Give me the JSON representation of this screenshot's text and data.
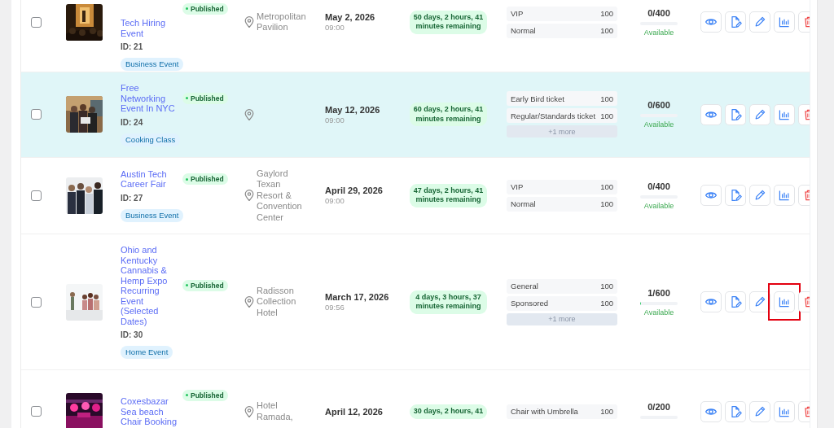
{
  "events": [
    {
      "title": "Tech Hiring Event",
      "id": "ID: 21",
      "category": "Business Event",
      "status": "Published",
      "location": "Metropolitan Pavilion",
      "date": "May 2, 2026",
      "time": "09:00",
      "remaining": "50 days, 2 hours, 41 minutes remaining",
      "tickets": [
        {
          "name": "VIP",
          "qty": "100"
        },
        {
          "name": "Normal",
          "qty": "100"
        }
      ],
      "sold": "0/400",
      "level": 0,
      "availability": "Available",
      "selected": false,
      "checked": false,
      "actions": [
        {
          "kind": "view",
          "highlighted": false
        },
        {
          "kind": "document",
          "highlighted": false
        },
        {
          "kind": "edit",
          "highlighted": false
        },
        {
          "kind": "stats",
          "highlighted": false
        },
        {
          "kind": "delete",
          "highlighted": false
        }
      ]
    },
    {
      "title": "Free Networking Event In NYC",
      "id": "ID: 24",
      "category": "Cooking Class",
      "status": "Published",
      "date": "May 12, 2026",
      "time": "09:00",
      "remaining": "60 days, 2 hours, 41 minutes remaining",
      "tickets": [
        {
          "name": "Early Bird ticket",
          "qty": "100"
        },
        {
          "name": "Regular/Standards ticket",
          "qty": "100"
        }
      ],
      "more": "+1 more",
      "sold": "0/600",
      "level": 0,
      "availability": "Available",
      "selected": true,
      "checked": false,
      "actions": [
        {
          "kind": "view",
          "highlighted": false
        },
        {
          "kind": "document",
          "highlighted": false
        },
        {
          "kind": "edit",
          "highlighted": false
        },
        {
          "kind": "stats",
          "highlighted": false
        },
        {
          "kind": "delete",
          "highlighted": false
        }
      ]
    },
    {
      "title": "Austin Tech Career Fair",
      "id": "ID: 27",
      "category": "Business Event",
      "status": "Published",
      "location": "Gaylord Texan Resort & Convention Center",
      "date": "April 29, 2026",
      "time": "09:00",
      "remaining": "47 days, 2 hours, 41 minutes remaining",
      "tickets": [
        {
          "name": "VIP",
          "qty": "100"
        },
        {
          "name": "Normal",
          "qty": "100"
        }
      ],
      "sold": "0/400",
      "level": 0,
      "availability": "Available",
      "selected": false,
      "checked": false,
      "actions": [
        {
          "kind": "view",
          "highlighted": false
        },
        {
          "kind": "document",
          "highlighted": false
        },
        {
          "kind": "edit",
          "highlighted": false
        },
        {
          "kind": "stats",
          "highlighted": false
        },
        {
          "kind": "delete",
          "highlighted": false
        }
      ]
    },
    {
      "title": "Ohio and Kentucky Cannabis & Hemp Expo Recurring Event (Selected Dates)",
      "id": "ID: 30",
      "category": "Home Event",
      "status": "Published",
      "location": "Radisson Collection Hotel",
      "date": "March 17, 2026",
      "time": "09:56",
      "remaining": "4 days, 3 hours, 37 minutes remaining",
      "tickets": [
        {
          "name": "General",
          "qty": "100"
        },
        {
          "name": "Sponsored",
          "qty": "100"
        }
      ],
      "more": "+1 more",
      "sold": "1/600",
      "level": 0.02,
      "availability": "Available",
      "selected": false,
      "checked": false,
      "actions": [
        {
          "kind": "view",
          "highlighted": false
        },
        {
          "kind": "document",
          "highlighted": false
        },
        {
          "kind": "edit",
          "highlighted": false
        },
        {
          "kind": "stats",
          "highlighted": true
        },
        {
          "kind": "delete",
          "highlighted": false
        }
      ]
    },
    {
      "title": "Coxesbazar Sea beach Chair Booking",
      "status": "Published",
      "location": "Hotel Ramada,",
      "date": "April 12, 2026",
      "remaining": "30 days, 2 hours, 41",
      "tickets": [
        {
          "name": "Chair with Umbrella",
          "qty": "100"
        }
      ],
      "sold": "0/200",
      "level": 0,
      "selected": false,
      "checked": false,
      "actions": [
        {
          "kind": "view",
          "highlighted": false
        },
        {
          "kind": "document",
          "highlighted": false
        },
        {
          "kind": "edit",
          "highlighted": false
        },
        {
          "kind": "stats",
          "highlighted": false
        },
        {
          "kind": "delete",
          "highlighted": false
        }
      ]
    }
  ]
}
